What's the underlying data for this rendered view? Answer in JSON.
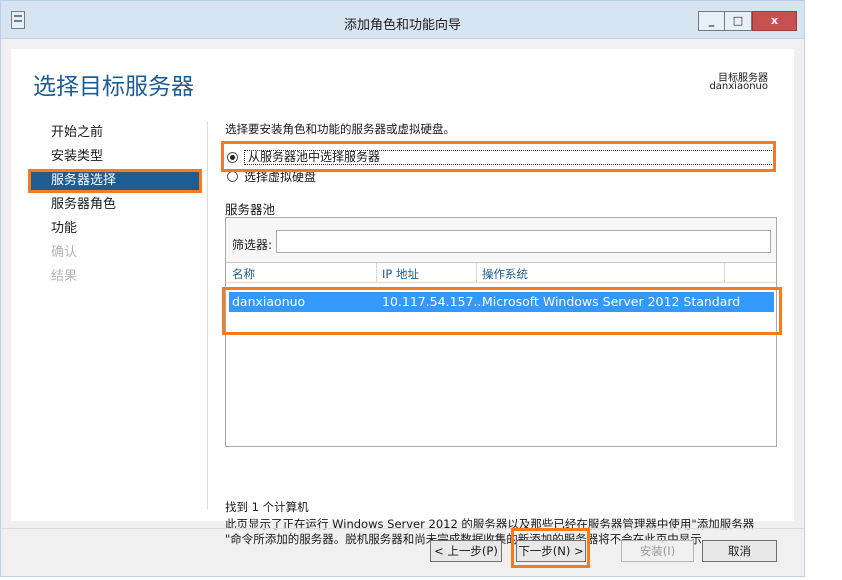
{
  "window": {
    "title": "添加角色和功能向导",
    "minimize_label": "_",
    "maximize_label": "□",
    "close_label": "x"
  },
  "header": {
    "page_title": "选择目标服务器",
    "dest_label": "目标服务器",
    "dest_server": "danxiaonuo"
  },
  "nav": {
    "items": [
      {
        "label": "开始之前",
        "state": "normal"
      },
      {
        "label": "安装类型",
        "state": "normal"
      },
      {
        "label": "服务器选择",
        "state": "active"
      },
      {
        "label": "服务器角色",
        "state": "normal"
      },
      {
        "label": "功能",
        "state": "normal"
      },
      {
        "label": "确认",
        "state": "disabled"
      },
      {
        "label": "结果",
        "state": "disabled"
      }
    ]
  },
  "main": {
    "instruction": "选择要安装角色和功能的服务器或虚拟硬盘。",
    "radio_pool_label": "从服务器池中选择服务器",
    "radio_vhd_label": "选择虚拟硬盘",
    "pool_label": "服务器池",
    "filter_label": "筛选器:",
    "filter_value": "",
    "columns": [
      "名称",
      "IP 地址",
      "操作系统"
    ],
    "rows": [
      {
        "name": "danxiaonuo",
        "ip": "10.117.54.157...",
        "os": "Microsoft Windows Server 2012 Standard"
      }
    ],
    "found_text": "找到 1 个计算机",
    "info_line1": "此页显示了正在运行 Windows Server 2012 的服务器以及那些已经在服务器管理器中使用\"添加服务器",
    "info_line2": "\"命令所添加的服务器。脱机服务器和尚未完成数据收集的新添加的服务器将不会在此页中显示。"
  },
  "buttons": {
    "prev": "< 上一步(P)",
    "next": "下一步(N) >",
    "install": "安装(I)",
    "cancel": "取消"
  },
  "colors": {
    "accent": "#1e5c94",
    "highlight": "#f47b20",
    "selection": "#3399ff"
  }
}
